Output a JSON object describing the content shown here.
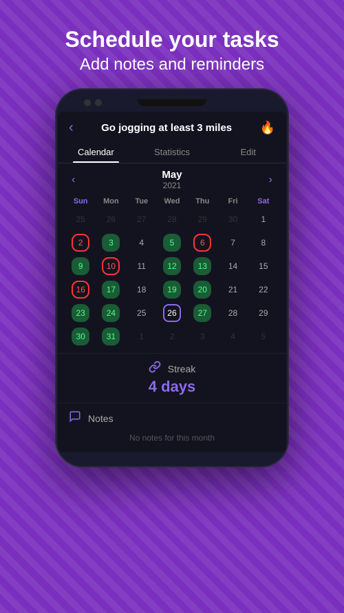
{
  "header": {
    "title_line1": "Schedule your tasks",
    "title_line2": "Add notes and reminders"
  },
  "appBar": {
    "back_icon": "‹",
    "title": "Go jogging at least 3 miles",
    "flame_icon": "🔥"
  },
  "tabs": [
    {
      "id": "calendar",
      "label": "Calendar",
      "active": true
    },
    {
      "id": "statistics",
      "label": "Statistics",
      "active": false
    },
    {
      "id": "edit",
      "label": "Edit",
      "active": false
    }
  ],
  "calendar": {
    "month": "May",
    "year": "2021",
    "nav_prev": "‹",
    "nav_next": "›",
    "days_of_week": [
      "Sun",
      "Mon",
      "Tue",
      "Wed",
      "Thu",
      "Fri",
      "Sat"
    ],
    "weeks": [
      [
        {
          "num": "25",
          "type": "other"
        },
        {
          "num": "26",
          "type": "other"
        },
        {
          "num": "27",
          "type": "other"
        },
        {
          "num": "28",
          "type": "other"
        },
        {
          "num": "29",
          "type": "other"
        },
        {
          "num": "30",
          "type": "other"
        },
        {
          "num": "1",
          "type": "current"
        }
      ],
      [
        {
          "num": "2",
          "type": "red"
        },
        {
          "num": "3",
          "type": "green"
        },
        {
          "num": "4",
          "type": "current"
        },
        {
          "num": "5",
          "type": "green"
        },
        {
          "num": "6",
          "type": "red"
        },
        {
          "num": "7",
          "type": "current"
        },
        {
          "num": "8",
          "type": "current"
        }
      ],
      [
        {
          "num": "9",
          "type": "green"
        },
        {
          "num": "10",
          "type": "red"
        },
        {
          "num": "11",
          "type": "current"
        },
        {
          "num": "12",
          "type": "green"
        },
        {
          "num": "13",
          "type": "green"
        },
        {
          "num": "14",
          "type": "current"
        },
        {
          "num": "15",
          "type": "current"
        }
      ],
      [
        {
          "num": "16",
          "type": "red"
        },
        {
          "num": "17",
          "type": "green"
        },
        {
          "num": "18",
          "type": "current"
        },
        {
          "num": "19",
          "type": "green"
        },
        {
          "num": "20",
          "type": "green"
        },
        {
          "num": "21",
          "type": "current"
        },
        {
          "num": "22",
          "type": "current"
        }
      ],
      [
        {
          "num": "23",
          "type": "green"
        },
        {
          "num": "24",
          "type": "green"
        },
        {
          "num": "25",
          "type": "current"
        },
        {
          "num": "26",
          "type": "today"
        },
        {
          "num": "27",
          "type": "green"
        },
        {
          "num": "28",
          "type": "current"
        },
        {
          "num": "29",
          "type": "current"
        }
      ],
      [
        {
          "num": "30",
          "type": "green"
        },
        {
          "num": "31",
          "type": "green"
        },
        {
          "num": "1",
          "type": "other"
        },
        {
          "num": "2",
          "type": "other"
        },
        {
          "num": "3",
          "type": "other"
        },
        {
          "num": "4",
          "type": "other"
        },
        {
          "num": "5",
          "type": "other"
        }
      ]
    ]
  },
  "streak": {
    "icon": "🔗",
    "label": "Streak",
    "value": "4 days"
  },
  "notes": {
    "icon": "💬",
    "label": "Notes",
    "empty_message": "No notes for this month"
  }
}
